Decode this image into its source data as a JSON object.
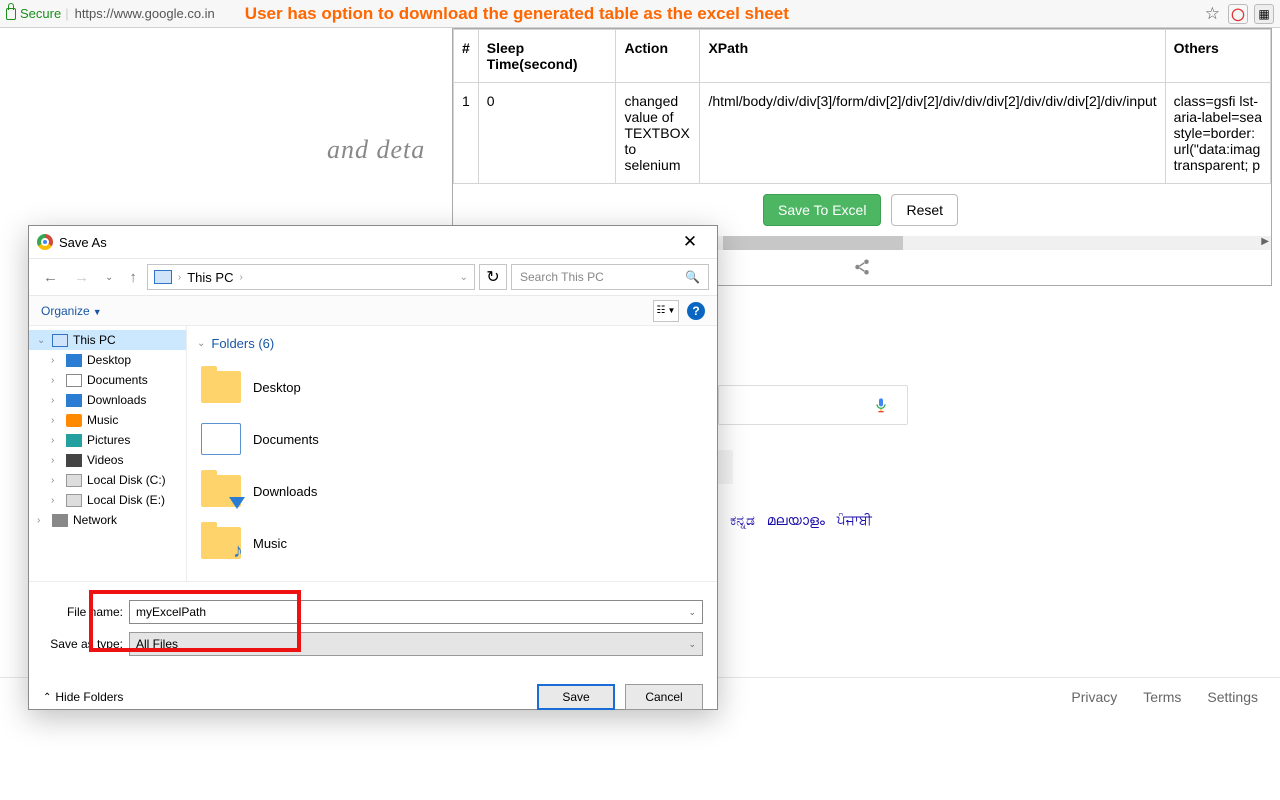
{
  "browser": {
    "secure": "Secure",
    "url": "https://www.google.co.in",
    "annotation": "User has option to download the generated table as the excel sheet"
  },
  "ext": {
    "headers": {
      "num": "#",
      "sleep": "Sleep Time(second)",
      "action": "Action",
      "xpath": "XPath",
      "others": "Others"
    },
    "row": {
      "num": "1",
      "sleep": "0",
      "action": "changed value of TEXTBOX to selenium",
      "xpath": "/html/body/div/div[3]/form/div[2]/div[2]/div/div/div[2]/div/div/div[2]/div/input",
      "others": "class=gsfi lst-\naria-label=sea\nstyle=border:\nurl(\"data:imag\ntransparent; p"
    },
    "save_btn": "Save To Excel",
    "reset_btn": "Reset"
  },
  "google": {
    "bg_text": "and deta",
    "languages": [
      "ಕನ್ನಡ",
      "മലയാളം",
      "ਪੰਜਾਬੀ"
    ],
    "footer": [
      "Privacy",
      "Terms",
      "Settings"
    ]
  },
  "saveas": {
    "title": "Save As",
    "breadcrumb": "This PC",
    "search_placeholder": "Search This PC",
    "organize": "Organize",
    "tree": [
      {
        "label": "This PC",
        "sel": true,
        "ic": "ic-pc",
        "exp": "⌄"
      },
      {
        "label": "Desktop",
        "ic": "ic-desk",
        "exp": "›",
        "indent": 1
      },
      {
        "label": "Documents",
        "ic": "ic-doc",
        "exp": "›",
        "indent": 1
      },
      {
        "label": "Downloads",
        "ic": "ic-dl",
        "exp": "›",
        "indent": 1
      },
      {
        "label": "Music",
        "ic": "ic-mus",
        "exp": "›",
        "indent": 1
      },
      {
        "label": "Pictures",
        "ic": "ic-pic",
        "exp": "›",
        "indent": 1
      },
      {
        "label": "Videos",
        "ic": "ic-vid",
        "exp": "›",
        "indent": 1
      },
      {
        "label": "Local Disk (C:)",
        "ic": "ic-disk",
        "exp": "›",
        "indent": 1
      },
      {
        "label": "Local Disk (E:)",
        "ic": "ic-disk",
        "exp": "›",
        "indent": 1
      },
      {
        "label": "Network",
        "ic": "ic-net",
        "exp": "›"
      }
    ],
    "folders_hdr": "Folders (6)",
    "folders": [
      {
        "label": "Desktop",
        "cls": ""
      },
      {
        "label": "Documents",
        "cls": "doc"
      },
      {
        "label": "Downloads",
        "cls": "dl"
      },
      {
        "label": "Music",
        "cls": "mus"
      }
    ],
    "filename_label": "File name:",
    "filename_value": "myExcelPath",
    "type_label": "Save as type:",
    "type_value": "All Files",
    "hide_folders": "Hide Folders",
    "save": "Save",
    "cancel": "Cancel"
  }
}
